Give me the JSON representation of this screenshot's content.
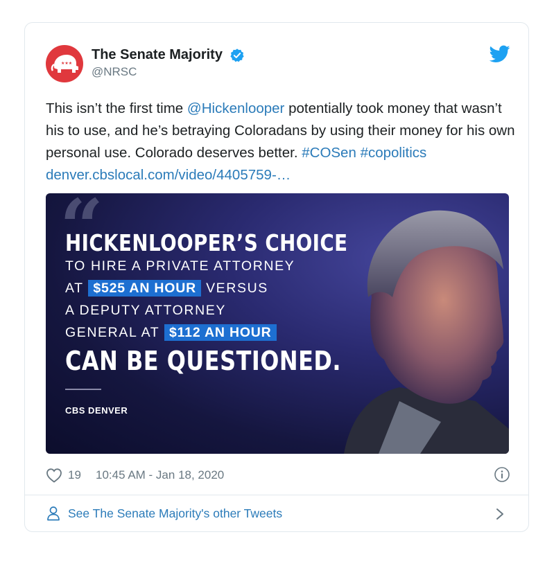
{
  "author": {
    "name": "The Senate Majority",
    "handle": "@NRSC",
    "avatar_icon": "republican-elephant-logo",
    "brand_color": "#e0383d"
  },
  "tweet": {
    "text_segments": [
      {
        "t": "This isn’t the first time ",
        "link": false
      },
      {
        "t": "@Hickenlooper",
        "link": true
      },
      {
        "t": " potentially took money that wasn’t his to use, and he’s betraying Coloradans by using their money for his own personal use. Colorado deserves better. ",
        "link": false
      },
      {
        "t": "#COSen",
        "link": true
      },
      {
        "t": " ",
        "link": false
      },
      {
        "t": "#copolitics",
        "link": true
      },
      {
        "t": " ",
        "link": false
      },
      {
        "t": "denver.cbslocal.com/video/4405759-…",
        "link": true
      }
    ],
    "link_color": "#2b7bb9"
  },
  "media": {
    "headline_top": "HICKENLOOPER’S CHOICE",
    "line1": "TO HIRE A PRIVATE ATTORNEY",
    "line2_pre": "AT",
    "line2_highlight": "$525 AN HOUR",
    "line2_post": "VERSUS",
    "line3": "A DEPUTY ATTORNEY",
    "line4_pre": "GENERAL AT",
    "line4_highlight": "$112 AN HOUR",
    "headline_bottom": "CAN BE QUESTIONED.",
    "source": "CBS DENVER",
    "highlight_color": "#1d6fd1"
  },
  "meta": {
    "likes": "19",
    "timestamp": "10:45 AM - Jan 18, 2020"
  },
  "footer": {
    "label": "See The Senate Majority's other Tweets"
  }
}
